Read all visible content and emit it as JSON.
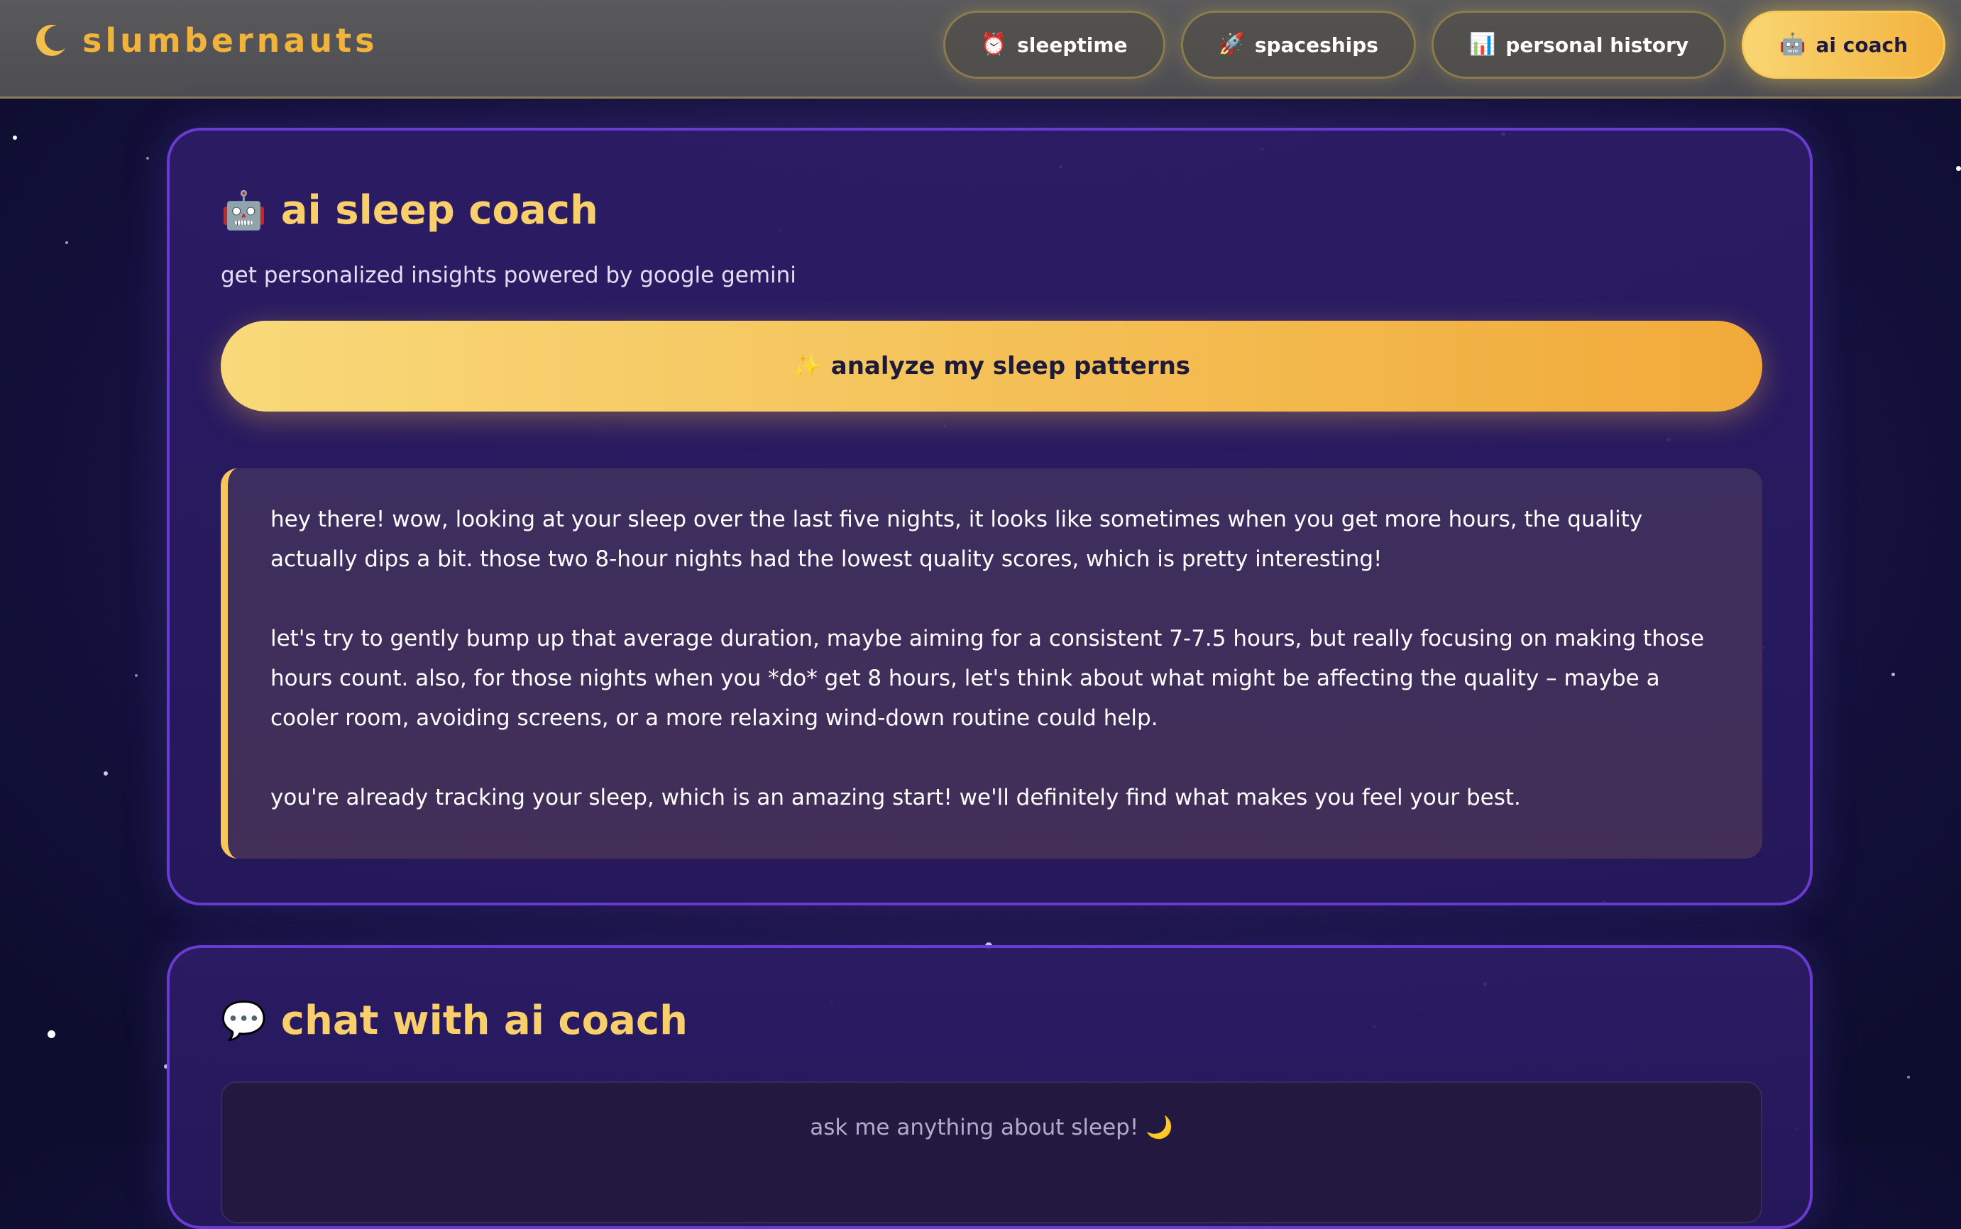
{
  "app": {
    "name": "slumbernauts",
    "logo_icon": "crescent-moon-icon"
  },
  "nav": {
    "items": [
      {
        "label": "sleeptime",
        "icon": "⏰",
        "active": false
      },
      {
        "label": "spaceships",
        "icon": "🚀",
        "active": false
      },
      {
        "label": "personal history",
        "icon": "📊",
        "active": false
      },
      {
        "label": "ai coach",
        "icon": "🤖",
        "active": true
      }
    ]
  },
  "coach": {
    "icon": "🤖",
    "title": "ai sleep coach",
    "subtitle": "get personalized insights powered by google gemini",
    "analyze_button": {
      "icon": "✨",
      "label": "analyze my sleep patterns"
    },
    "insight_paragraphs": [
      "hey there! wow, looking at your sleep over the last five nights, it looks like sometimes when you get more hours, the quality actually dips a bit. those two 8-hour nights had the lowest quality scores, which is pretty interesting!",
      "let's try to gently bump up that average duration, maybe aiming for a consistent 7-7.5 hours, but really focusing on making those hours count. also, for those nights when you *do* get 8 hours, let's think about what might be affecting the quality – maybe a cooler room, avoiding screens, or a more relaxing wind-down routine could help.",
      "you're already tracking your sleep, which is an amazing start! we'll definitely find what makes you feel your best."
    ]
  },
  "chat": {
    "icon": "💬",
    "title": "chat with ai coach",
    "placeholder": "ask me anything about sleep! 🌙"
  },
  "colors": {
    "accent": "#f2b33c",
    "card_border": "#6a3bd1",
    "background": "#1d1648"
  }
}
